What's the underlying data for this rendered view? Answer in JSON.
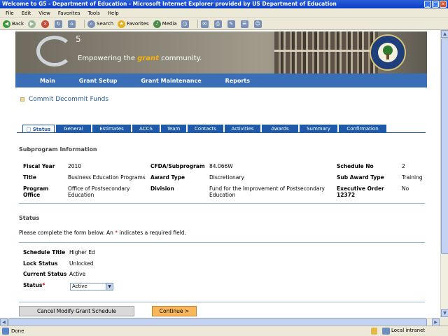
{
  "window": {
    "title": "Welcome to G5 - Department of Education - Microsoft Internet Explorer provided by US Department of Education"
  },
  "menu": [
    "File",
    "Edit",
    "View",
    "Favorites",
    "Tools",
    "Help"
  ],
  "toolbar": {
    "back": "Back",
    "search": "Search",
    "favorites": "Favorites",
    "media": "Media"
  },
  "banner": {
    "logo_number": "5",
    "tagline_pre": "Empowering the ",
    "tagline_hl": "grant",
    "tagline_post": " community."
  },
  "nav": [
    "Main",
    "Grant Setup",
    "Grant Maintenance",
    "Reports"
  ],
  "page": {
    "title": "Commit Decommit Funds"
  },
  "tabs": [
    "Status",
    "General",
    "Estimates",
    "ACCS",
    "Team",
    "Contacts",
    "Activities",
    "Awards",
    "Summary",
    "Confirmation"
  ],
  "subprogram": {
    "heading": "Subprogram Information",
    "fiscal_year_label": "Fiscal Year",
    "fiscal_year": "2010",
    "cfda_label": "CFDA/Subprogram",
    "cfda": "84.066W",
    "schedule_no_label": "Schedule No",
    "schedule_no": "2",
    "title_label": "Title",
    "title": "Business Education Programs",
    "award_type_label": "Award Type",
    "award_type": "Discretionary",
    "sub_award_type_label": "Sub Award Type",
    "sub_award_type": "Training",
    "program_office_label": "Program Office",
    "program_office": "Office of Postsecondary Education",
    "division_label": "Division",
    "division": "Fund for the Improvement of Postsecondary Education",
    "exec_order_label": "Executive Order 12372",
    "exec_order": "No"
  },
  "status": {
    "heading": "Status",
    "instr_pre": "Please complete the form below. An ",
    "instr_star": "*",
    "instr_post": " indicates a required field.",
    "schedule_title_label": "Schedule Title",
    "schedule_title": "Higher Ed",
    "lock_status_label": "Lock Status",
    "lock_status": "Unlocked",
    "current_status_label": "Current Status",
    "current_status": "Active",
    "status_label": "Status",
    "status_required": "*",
    "status_selected": "Active"
  },
  "buttons": {
    "cancel": "Cancel Modify Grant Schedule",
    "continue": "Continue >"
  },
  "statusbar": {
    "left": "Done",
    "right": "Local intranet"
  }
}
